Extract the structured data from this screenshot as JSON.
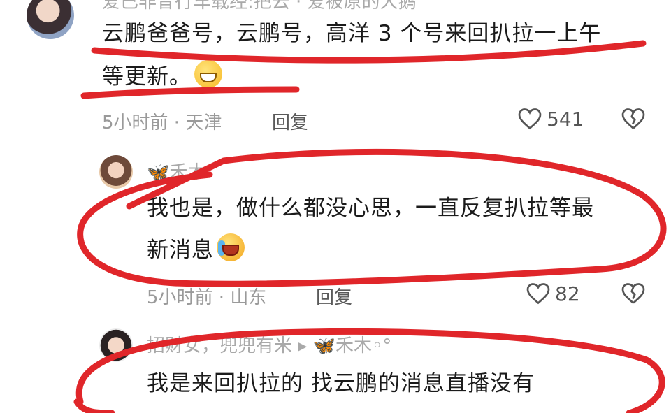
{
  "comments": [
    {
      "username": "爱已非昔行车载经:把云 · 爱被原的大鹅",
      "text_line1": "云鹏爸爸号，云鹏号，高洋 3 个号来回扒拉一上午",
      "text_line2": "等更新。",
      "meta": "5小时前 · 天津",
      "reply_label": "回复",
      "likes": "541"
    },
    {
      "username": "🦋禾木",
      "text_line1": "我也是，做什么都没心思，一直反复扒拉等最",
      "text_line2": "新消息",
      "meta": "5小时前 · 山东",
      "reply_label": "回复",
      "likes": "82"
    },
    {
      "username": "招财女，兜兜有米 ▸ 🦋禾木◦°",
      "text_line1": "我是来回扒拉的 找云鹏的消息直播没有"
    }
  ],
  "colors": {
    "annotation_red": "#e0262a",
    "meta_gray": "#9a9a9a"
  },
  "icons": [
    "heart-outline-icon",
    "broken-heart-icon",
    "grin-emoji-icon",
    "crying-emoji-icon",
    "reply-arrow-icon"
  ]
}
